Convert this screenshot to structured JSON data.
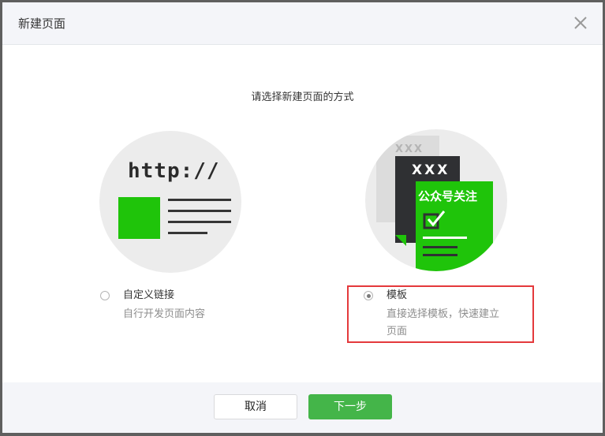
{
  "dialog": {
    "title": "新建页面",
    "subtitle": "请选择新建页面的方式"
  },
  "illustration_left": {
    "url_text": "http://"
  },
  "illustration_right": {
    "back_card_text": "XXX",
    "mid_card_text": "XXX",
    "front_card_text": "公众号关注"
  },
  "options": [
    {
      "label": "自定义链接",
      "description": "自行开发页面内容",
      "selected": false
    },
    {
      "label": "模板",
      "description": "直接选择模板，快速建立页面",
      "selected": true
    }
  ],
  "footer": {
    "cancel_label": "取消",
    "next_label": "下一步"
  },
  "colors": {
    "accent_green": "#44b549",
    "illustration_green": "#1fc40a",
    "highlight_red": "#e4393c"
  }
}
